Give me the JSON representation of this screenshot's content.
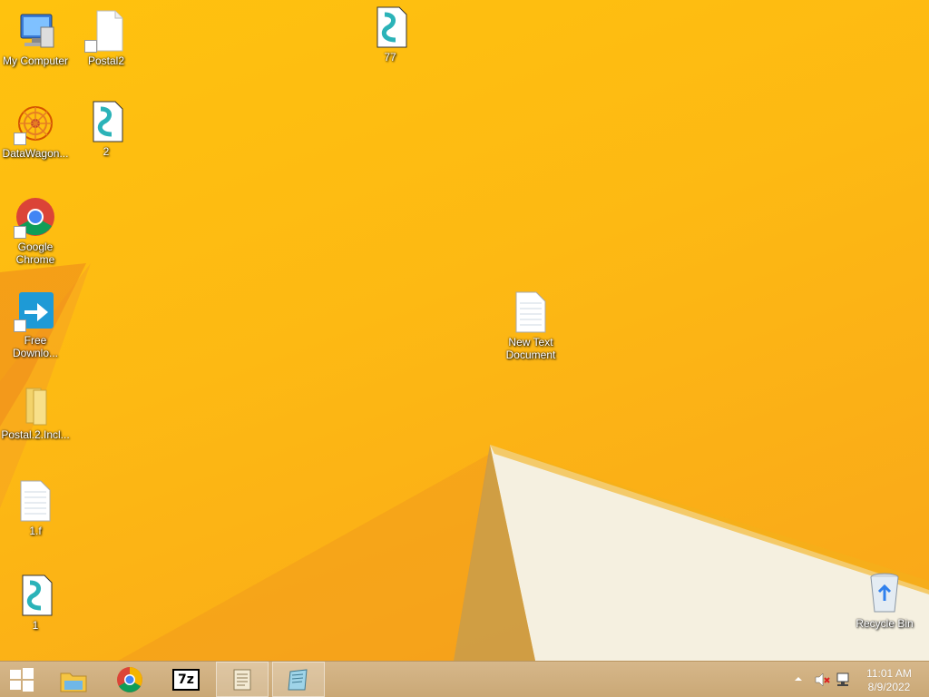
{
  "desktop_icons": {
    "my_computer": "My Computer",
    "postal2": "Postal2",
    "file_77": "77",
    "datawagon": "DataWagon...",
    "file_2": "2",
    "chrome": "Google Chrome",
    "free_download": "Free Downlo...",
    "postal_folder": "Postal.2.Incl...",
    "new_text_doc": "New Text Document",
    "file_1f": "1.f",
    "file_1": "1",
    "recycle_bin": "Recycle Bin"
  },
  "taskbar": {
    "time": "11:01 AM",
    "date": "8/9/2022",
    "sevenzip_label": "7z"
  },
  "colors": {
    "wallpaper_primary": "#fdb913",
    "wallpaper_shadow": "#f18a1c",
    "taskbar": "#cfad7c"
  }
}
